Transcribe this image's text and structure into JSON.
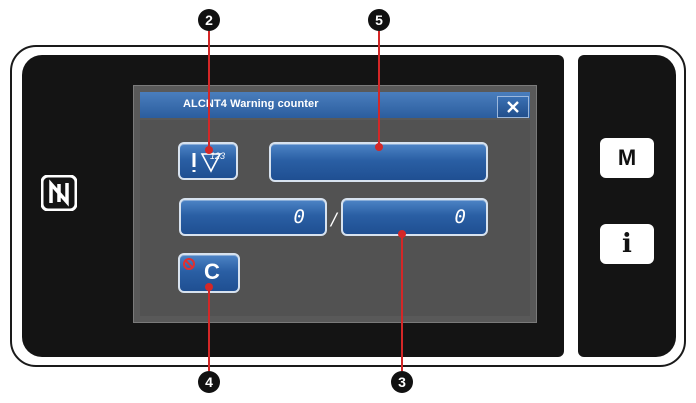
{
  "dialog": {
    "title": "ALCNT4  Warning counter",
    "close_icon": "close-icon"
  },
  "buttons": {
    "counter_icon_button": {
      "icon": "needle-counter-icon",
      "label": "123"
    },
    "counter_name_button": {
      "label": ""
    },
    "current_count": {
      "value": "0"
    },
    "separator": "/",
    "set_value": {
      "value": "0"
    },
    "clear_button": {
      "icon": "clear-counter-icon",
      "label": "C"
    }
  },
  "side_panel": {
    "mode_button": "M",
    "info_button": "i"
  },
  "callouts": {
    "two": "2",
    "five": "5",
    "three": "3",
    "four": "4"
  },
  "colors": {
    "accent": "#d42727",
    "button_blue": "#2a5fa4",
    "screen_bg": "#141414"
  }
}
